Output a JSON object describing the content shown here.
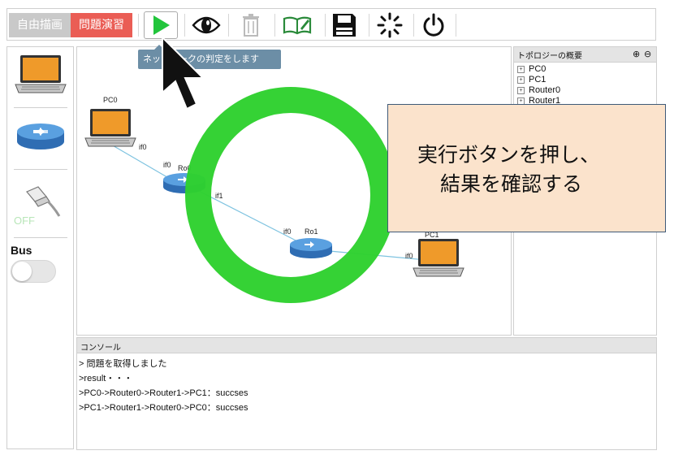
{
  "toolbar": {
    "mode_free_label": "自由描画",
    "mode_practice_label": "問題演習",
    "run_tooltip": "ネットワークの判定をします",
    "buttons": [
      "run",
      "view",
      "delete",
      "book",
      "save",
      "loading",
      "power"
    ]
  },
  "palette": {
    "items": [
      "laptop",
      "router",
      "cable"
    ],
    "off_label": "OFF",
    "bus_label": "Bus",
    "bus_enabled": false
  },
  "canvas": {
    "nodes": {
      "pc0": {
        "label": "PC0",
        "if_label": "if0"
      },
      "router0": {
        "label": "Ro0",
        "if0_label": "if0",
        "if1_label": "if1"
      },
      "router1": {
        "label": "Ro1",
        "if0_label": "if0"
      },
      "pc1": {
        "label": "PC1",
        "if_label": "if0"
      }
    }
  },
  "topology": {
    "title": "トポロジーの概要",
    "items": [
      "PC0",
      "PC1",
      "Router0",
      "Router1"
    ]
  },
  "console": {
    "title": "コンソール",
    "lines": [
      "> 問題を取得しました",
      ">result・・・",
      ">PC0->Router0->Router1->PC1：succses",
      ">PC1->Router1->Router0->PC0：succses"
    ]
  },
  "callout": {
    "line1": "実行ボタンを押し、",
    "line2": "結果を確認する"
  },
  "colors": {
    "practice_active": "#ea5d55",
    "run_green": "#22c53c",
    "ring_green": "#2ed12e",
    "callout_bg": "#fbe3cc",
    "tooltip_bg": "#6c8ea6"
  }
}
